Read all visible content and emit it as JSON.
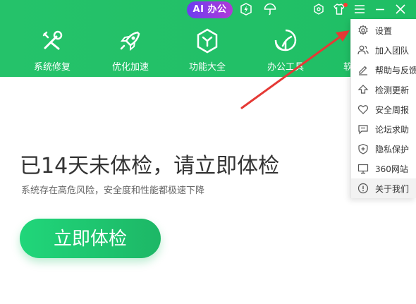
{
  "titlebar": {
    "ai_pill": "AI 办公",
    "icons": [
      "bolt-shield-icon",
      "umbrella-icon",
      "gear-icon",
      "shirt-icon",
      "menu-icon",
      "minimize-icon",
      "close-icon"
    ]
  },
  "nav": [
    {
      "label": "系统修复",
      "icon": "wrench-screwdriver-icon"
    },
    {
      "label": "优化加速",
      "icon": "rocket-icon"
    },
    {
      "label": "功能大全",
      "icon": "hexagon-icon"
    },
    {
      "label": "办公工具",
      "icon": "leaf-icon"
    },
    {
      "label": "软",
      "icon": ""
    }
  ],
  "main": {
    "headline": "已14天未体检，请立即体检",
    "subtext": "系统存在高危风险，安全度和性能都极速下降",
    "button": "立即体检"
  },
  "menu": {
    "items": [
      {
        "label": "设置",
        "icon": "gear-icon"
      },
      {
        "label": "加入团队",
        "icon": "users-icon"
      },
      {
        "label": "帮助与反馈",
        "icon": "pencil-icon"
      },
      {
        "label": "检测更新",
        "icon": "upload-icon"
      },
      {
        "label": "安全周报",
        "icon": "heart-icon"
      },
      {
        "label": "论坛求助",
        "icon": "chat-icon"
      },
      {
        "label": "隐私保护",
        "icon": "shield-plus-icon"
      },
      {
        "label": "360网站",
        "icon": "monitor-icon"
      },
      {
        "label": "关于我们",
        "icon": "info-icon"
      }
    ]
  },
  "colors": {
    "header_green": "#22c067",
    "button_green": "#20d67a",
    "arrow_red": "#e53935",
    "ai_pill_purple": "#8a3be4"
  }
}
